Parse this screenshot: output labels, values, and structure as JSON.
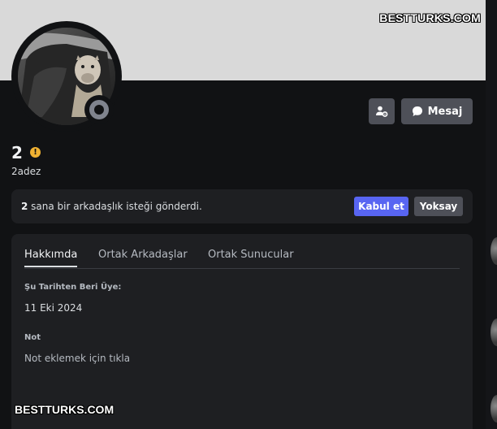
{
  "watermark": "BESTTURKS.COM",
  "profile": {
    "display_name": "2",
    "warning_icon": "exclamation-icon",
    "warning_glyph": "!",
    "username": "2adez",
    "status": "offline"
  },
  "actions": {
    "friend_icon": "user-settings-icon",
    "message_label": "Mesaj"
  },
  "friend_request": {
    "name": "2",
    "text": " sana bir arkadaşlık isteği gönderdi.",
    "accept_label": "Kabul et",
    "ignore_label": "Yoksay"
  },
  "tabs": [
    {
      "label": "Hakkımda",
      "active": true
    },
    {
      "label": "Ortak Arkadaşlar",
      "active": false
    },
    {
      "label": "Ortak Sunucular",
      "active": false
    }
  ],
  "about": {
    "member_since_title": "Şu Tarihten Beri Üye:",
    "member_since_value": "11 Eki 2024",
    "note_title": "Not",
    "note_placeholder": "Not eklemek için tıkla"
  },
  "colors": {
    "background": "#111214",
    "banner": "#d9d9d9",
    "card": "#1e1f22",
    "accent": "#5865f2",
    "secondary_button": "#4e5058",
    "warning": "#f0b232",
    "status_offline": "#80848e"
  }
}
